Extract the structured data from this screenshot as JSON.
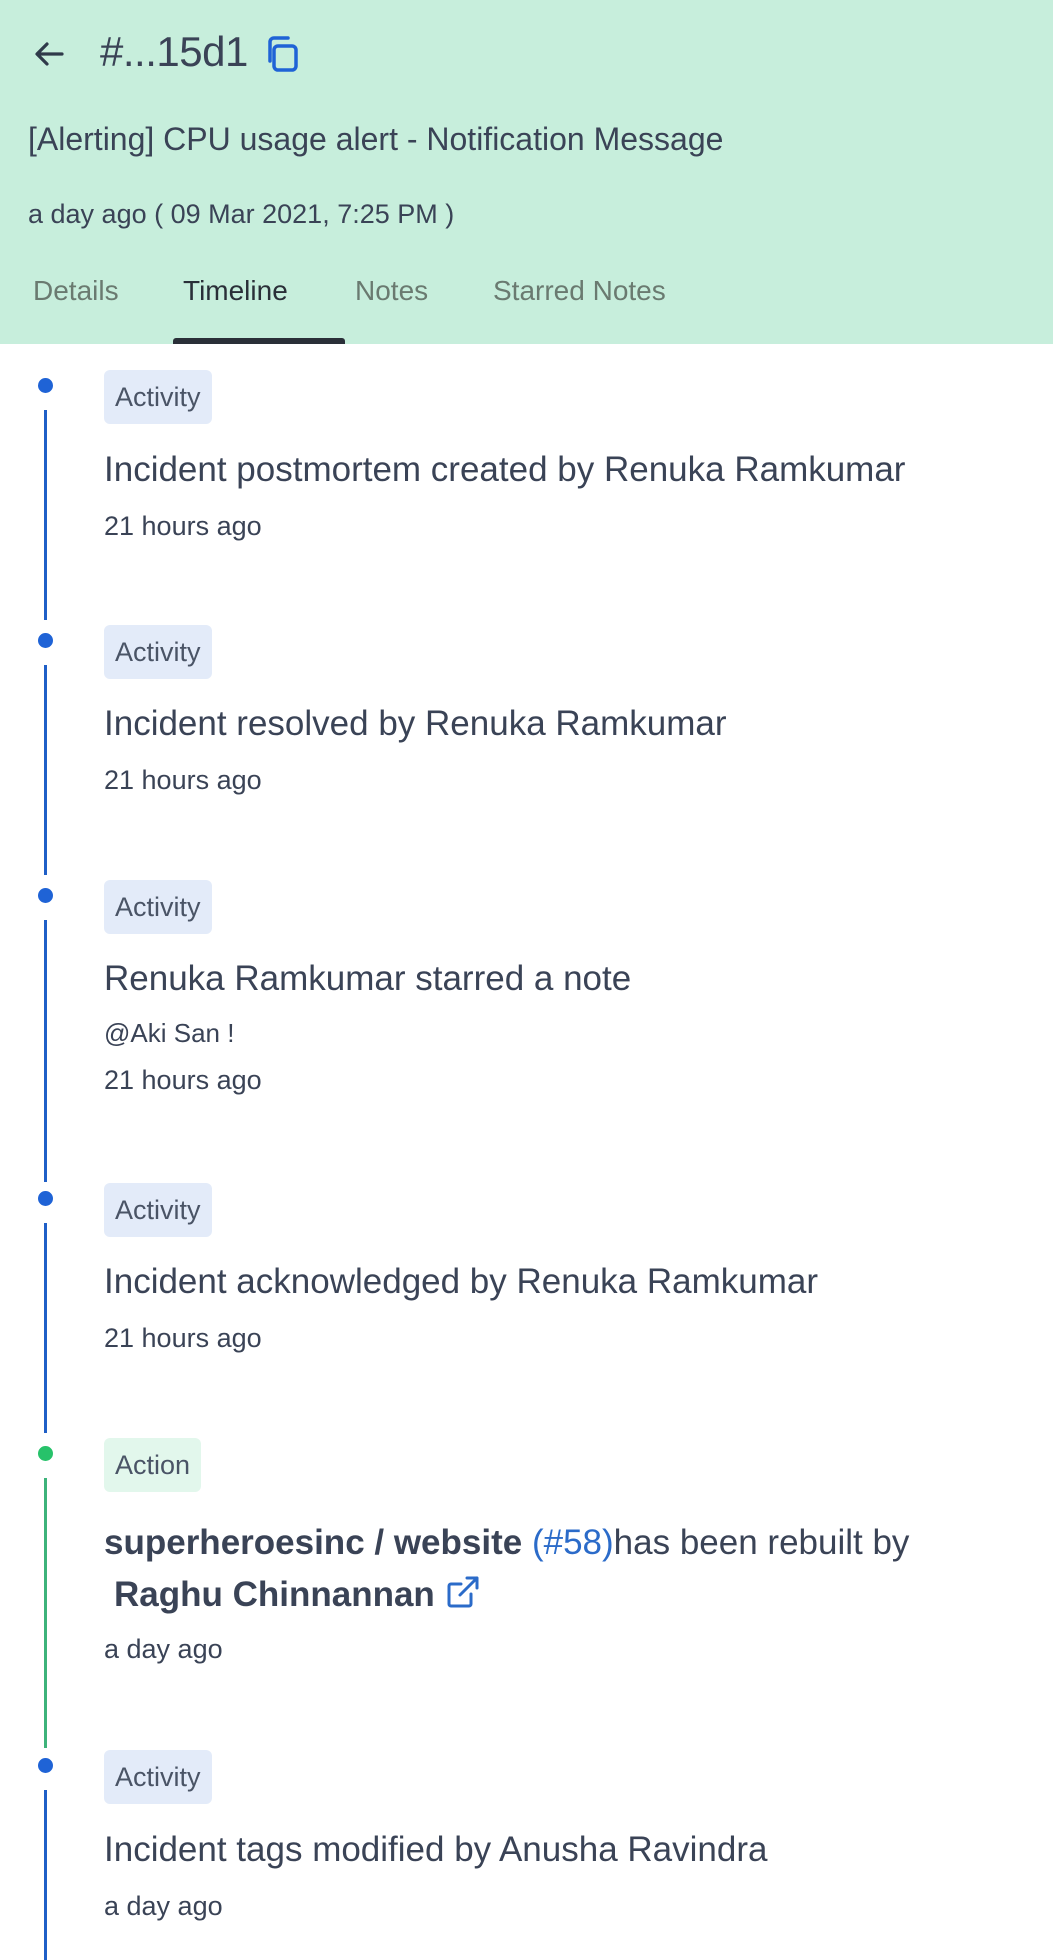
{
  "header": {
    "incident_id": "#...15d1",
    "title": "[Alerting] CPU usage alert - Notification Message",
    "created": "a day ago ( 09 Mar 2021, 7:25 PM )",
    "back_icon": "arrow-left-icon",
    "copy_icon": "copy-icon",
    "background_color": "#c7eedc"
  },
  "tabs": [
    {
      "label": "Details",
      "active": false
    },
    {
      "label": "Timeline",
      "active": true
    },
    {
      "label": "Notes",
      "active": false
    },
    {
      "label": "Starred Notes",
      "active": false
    }
  ],
  "timeline": [
    {
      "badge": "Activity",
      "text": "Incident postmortem created by Renuka Ramkumar",
      "time": "21 hours ago"
    },
    {
      "badge": "Activity",
      "text": "Incident resolved by Renuka Ramkumar",
      "time": "21 hours ago"
    },
    {
      "badge": "Activity",
      "text": "Renuka Ramkumar starred a note",
      "note": "@Aki San !",
      "time": "21 hours ago"
    },
    {
      "badge": "Activity",
      "text": "Incident acknowledged by Renuka Ramkumar",
      "time": "21 hours ago"
    },
    {
      "badge": "Action",
      "repo": "superheroesinc / website",
      "pr": "(#58)",
      "text_after": "has been rebuilt by",
      "user": "Raghu Chinnannan",
      "link_icon": "external-link-icon",
      "time": "a day ago"
    },
    {
      "badge": "Activity",
      "text": "Incident tags modified by Anusha Ravindra",
      "time": "a day ago"
    }
  ],
  "colors": {
    "activity_accent": "#1f63d6",
    "action_accent": "#27c26a",
    "link": "#2b6bc9"
  }
}
